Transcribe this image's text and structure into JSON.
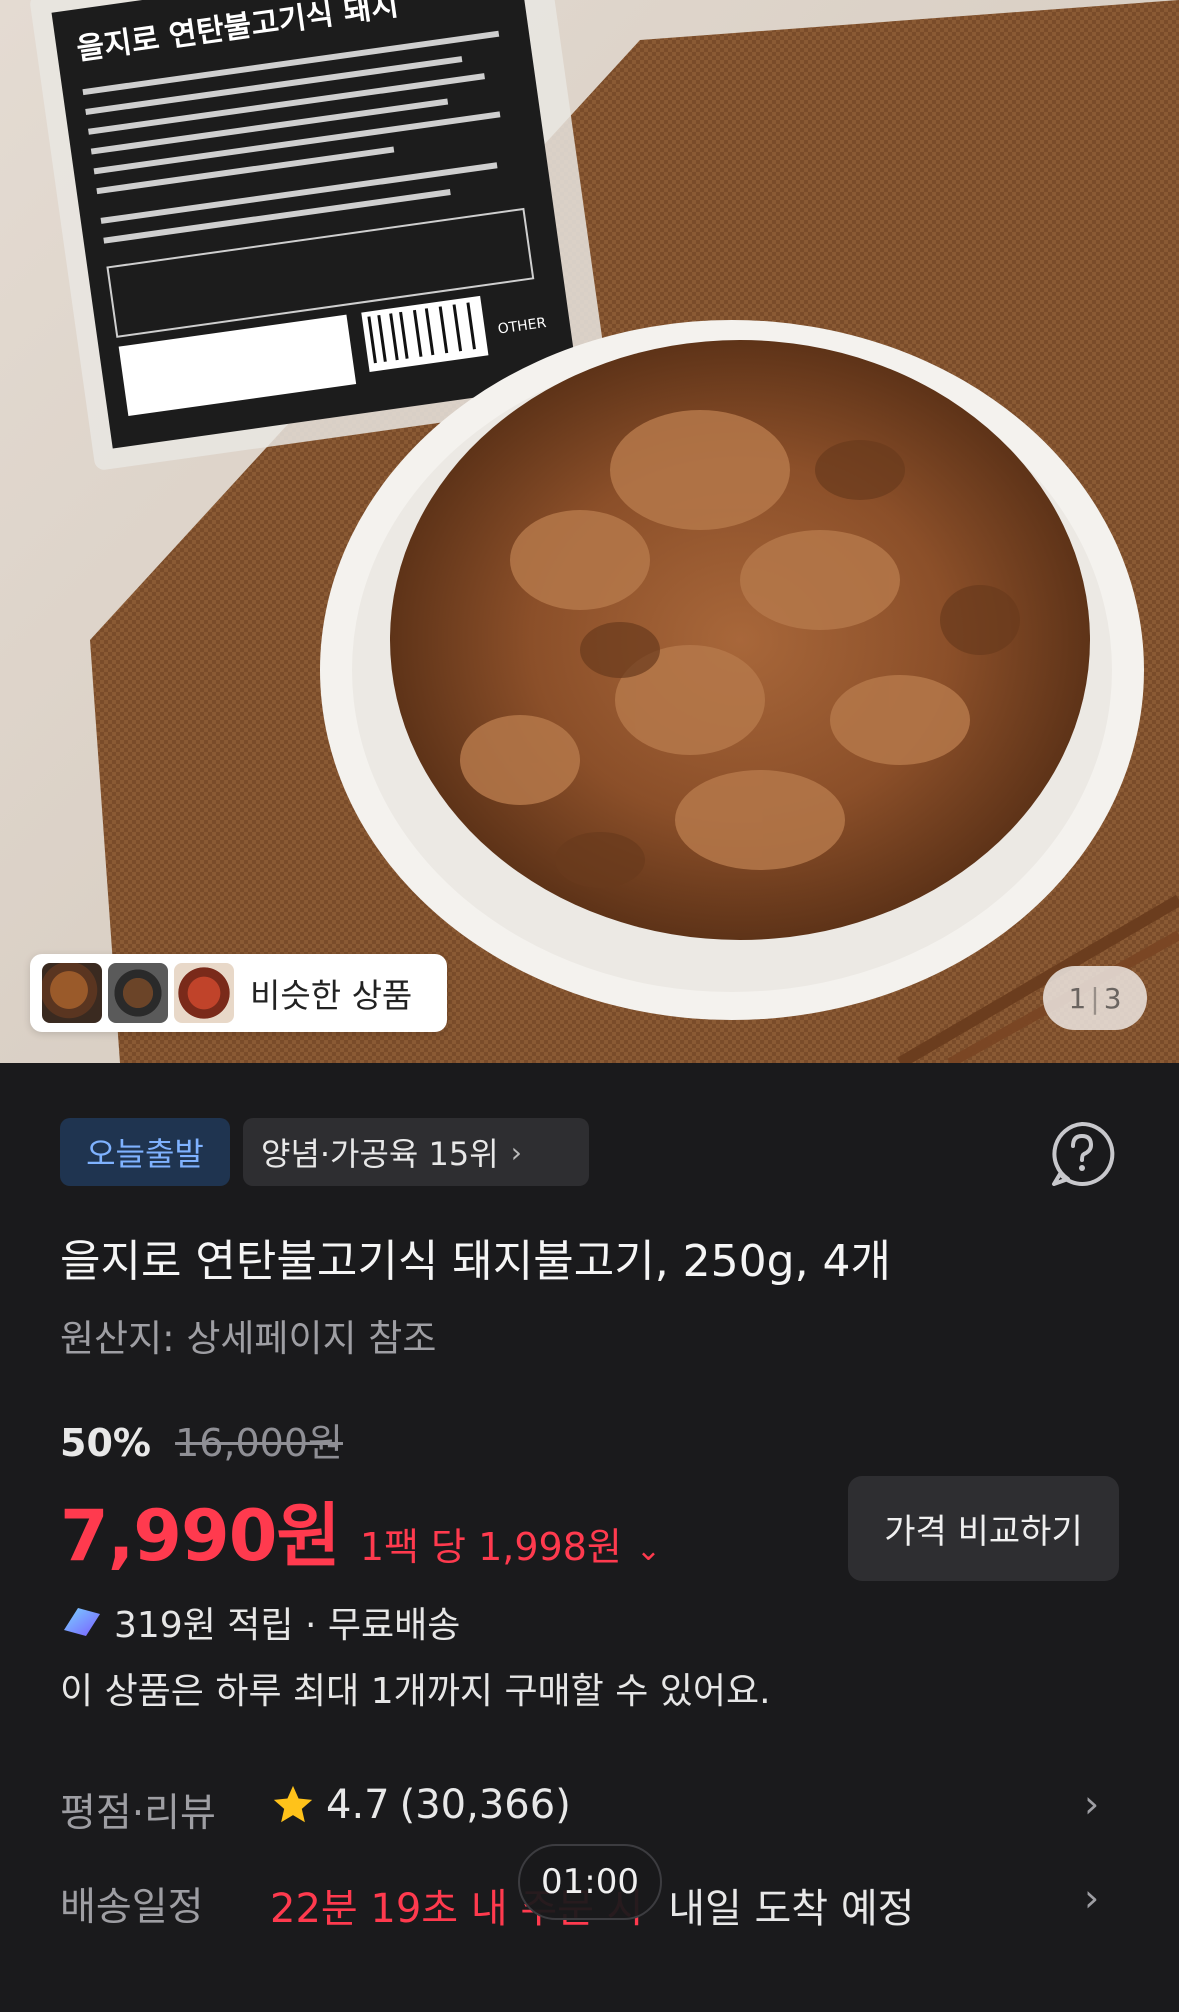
{
  "hero": {
    "similar_label": "비슷한 상품",
    "page_current": "1",
    "page_total": "3",
    "package_title": "을지로 연탄불고기식 돼지",
    "package_other_label": "OTHER"
  },
  "tags": {
    "today_label": "오늘출발",
    "rank_label": "양념·가공육 15위"
  },
  "product": {
    "title": "을지로 연탄불고기식 돼지불고기, 250g, 4개",
    "origin": "원산지: 상세페이지 참조"
  },
  "pricing": {
    "discount": "50%",
    "original_price": "16,000원",
    "price": "7,990원",
    "unit_price": "1팩 당 1,998원",
    "compare_label": "가격 비교하기"
  },
  "benefits": {
    "reward": "319원 적립 · 무료배송",
    "limit_notice": "이 상품은 하루 최대 1개까지 구매할 수 있어요."
  },
  "rating": {
    "label": "평점·리뷰",
    "score": "4.7",
    "count": "(30,366)"
  },
  "delivery": {
    "label": "배송일정",
    "countdown": "22분 19초 내 주문 시",
    "arrival": "내일 도착 예정"
  },
  "timer": "01:00",
  "icons": {
    "help": "question-circle-icon",
    "star": "star-icon",
    "reward": "reward-icon",
    "chevron": "chevron-right-icon"
  },
  "colors": {
    "accent_red": "#ff3a4e",
    "today_blue": "#7fb2ff",
    "background": "#1a1a1c"
  }
}
